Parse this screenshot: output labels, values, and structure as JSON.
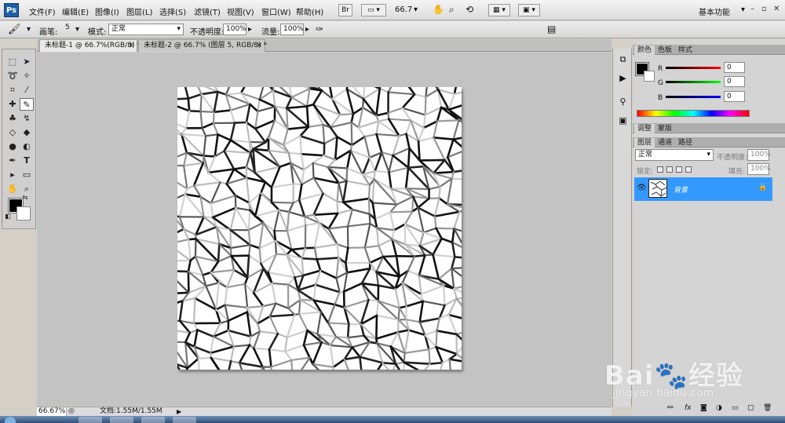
{
  "app": {
    "logo": "Ps"
  },
  "menu": [
    "文件(F)",
    "编辑(E)",
    "图像(I)",
    "图层(L)",
    "选择(S)",
    "滤镜(T)",
    "视图(V)",
    "窗口(W)",
    "帮助(H)"
  ],
  "menubar": {
    "bridge_label": "Br",
    "zoom_level": "66.7",
    "workspace": "基本功能",
    "win_min": "–",
    "win_restore": "▫",
    "win_close": "✕"
  },
  "options": {
    "brush_label": "画笔:",
    "brush_size": "5",
    "mode_label": "模式:",
    "mode_value": "正常",
    "opacity_label": "不透明度:",
    "opacity_value": "100%",
    "flow_label": "流量:",
    "flow_value": "100%"
  },
  "tabs": [
    "未标题-1 @ 66.7%(RGB/8) *",
    "未标题-2 @ 66.7% (图层 5, RGB/8) *"
  ],
  "status": {
    "zoom": "66.67%",
    "doc_info": "文档:1.55M/1.55M"
  },
  "colors": {
    "foreground": "#000000",
    "background": "#ffffff",
    "selection": "#3399ff",
    "canvas_bg": "#c3c3c3"
  },
  "panels": {
    "color_tabs": [
      "颜色",
      "色板",
      "样式"
    ],
    "channels": [
      {
        "label": "R",
        "value": "0"
      },
      {
        "label": "G",
        "value": "0"
      },
      {
        "label": "B",
        "value": "0"
      }
    ],
    "adjust_tabs": [
      "调整",
      "蒙版"
    ],
    "layer_tabs": [
      "图层",
      "通道",
      "路径"
    ],
    "blend_mode": "正常",
    "layer_opacity_label": "不透明度:",
    "layer_opacity": "100%",
    "lock_label": "锁定:",
    "fill_label": "填充:",
    "fill_value": "100%",
    "layers": [
      {
        "name": "背景"
      }
    ]
  },
  "icons": [
    "brush-icon",
    "marquee-icon",
    "move-icon",
    "lasso-icon",
    "magic-wand-icon",
    "crop-icon",
    "eyedropper-icon",
    "healing-icon",
    "stamp-icon",
    "history-brush-icon",
    "eraser-icon",
    "bucket-icon",
    "blur-icon",
    "dodge-icon",
    "pen-icon",
    "text-icon",
    "path-select-icon",
    "shape-icon",
    "hand-icon",
    "zoom-icon",
    "eye-icon",
    "lock-icon",
    "link-icon",
    "fx-icon",
    "mask-icon",
    "adjustment-icon",
    "folder-icon",
    "new-layer-icon",
    "trash-icon"
  ],
  "watermark": {
    "brand": "Bai",
    "brand_suffix": "经验",
    "url": "jingyan.baidu.com"
  }
}
